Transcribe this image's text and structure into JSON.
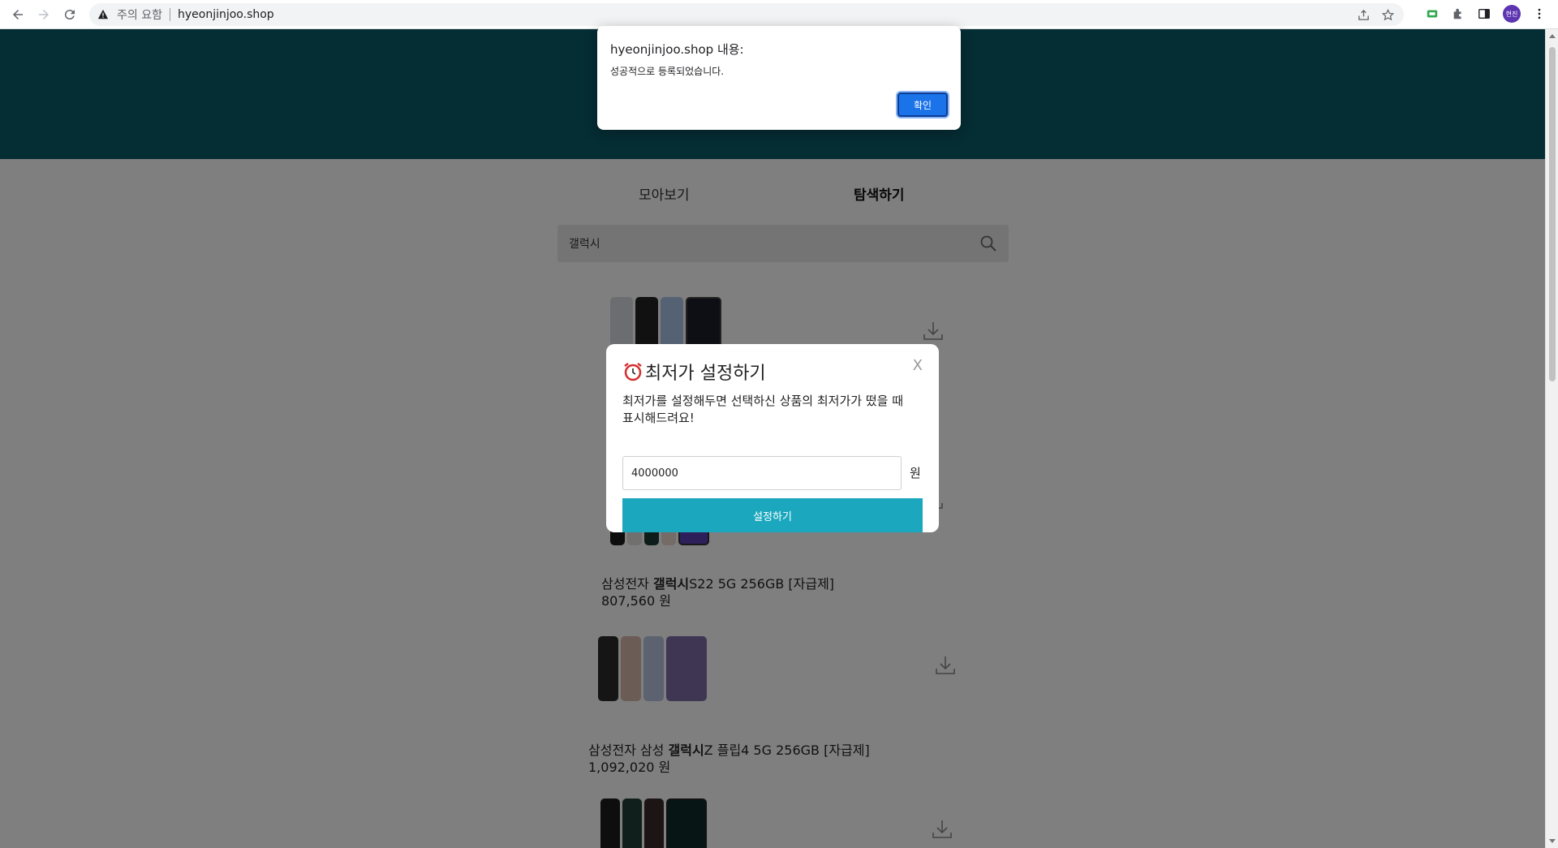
{
  "browser": {
    "security_warning": "주의 요함",
    "url": "hyeonjinjoo.shop",
    "profile_initials": "현진"
  },
  "page": {
    "tabs": [
      {
        "label": "모아보기",
        "active": false
      },
      {
        "label": "탐색하기",
        "active": true
      }
    ],
    "search": {
      "value": "갤럭시"
    },
    "products": [
      {
        "title_prefix": "",
        "title_keyword": "",
        "title_suffix": "",
        "price": ""
      },
      {
        "title_prefix": "삼성전자 ",
        "title_keyword": "갤럭시",
        "title_suffix": "S22 5G 256GB [자급제]",
        "price": "807,560 원"
      },
      {
        "title_prefix": "삼성전자 삼성 ",
        "title_keyword": "갤럭시",
        "title_suffix": "Z 플립4 5G 256GB [자급제]",
        "price": "1,092,020 원"
      }
    ]
  },
  "modal": {
    "title": "최저가 설정하기",
    "close_label": "X",
    "description_line1": "최저가를 설정해두면 선택하신 상품의 최저가가 떴을 때",
    "description_line2": "표시해드려요!",
    "price_value": "4000000",
    "unit": "원",
    "button_label": "설정하기"
  },
  "alert": {
    "title": "hyeonjinjoo.shop 내용:",
    "message": "성공적으로 등록되었습니다.",
    "ok_label": "확인"
  },
  "colors": {
    "header_band": "#0b5a68",
    "button_teal": "#1ba8be",
    "ok_blue": "#1a73e8"
  }
}
